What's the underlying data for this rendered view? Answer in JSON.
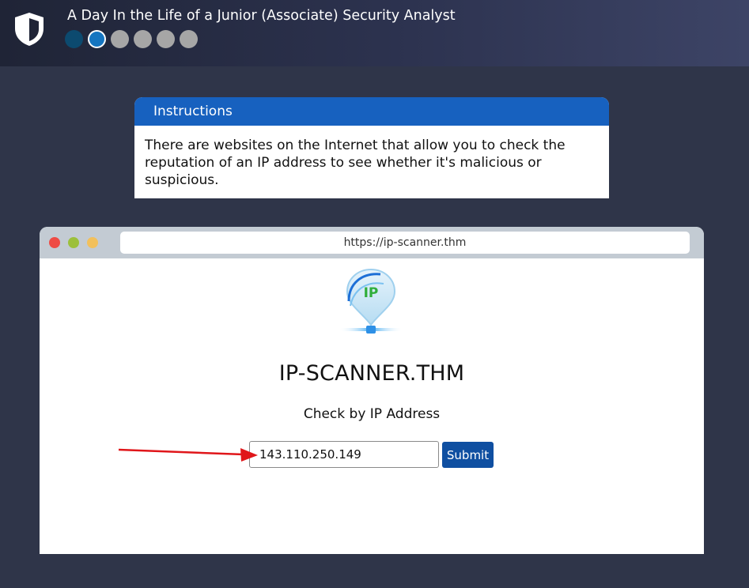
{
  "header": {
    "title": "A Day In the Life of a Junior (Associate) Security Analyst",
    "steps": [
      {
        "state": "done"
      },
      {
        "state": "current"
      },
      {
        "state": "pending"
      },
      {
        "state": "pending"
      },
      {
        "state": "pending"
      },
      {
        "state": "pending"
      }
    ],
    "logo_icon": "shield-icon"
  },
  "instructions": {
    "heading": "Instructions",
    "body": "There are websites on the Internet that allow you to check the reputation of an IP address to see whether it's malicious or suspicious."
  },
  "browser": {
    "url": "https://ip-scanner.thm",
    "site": {
      "logo_text": "IP",
      "title": "IP-SCANNER.THM",
      "subtitle": "Check by IP Address",
      "ip_value": "143.110.250.149",
      "submit_label": "Submit"
    }
  },
  "colors": {
    "accent_blue": "#1761bf",
    "submit_blue": "#0f4fa1",
    "arrow_red": "#e0161a",
    "background": "#2f3549"
  }
}
